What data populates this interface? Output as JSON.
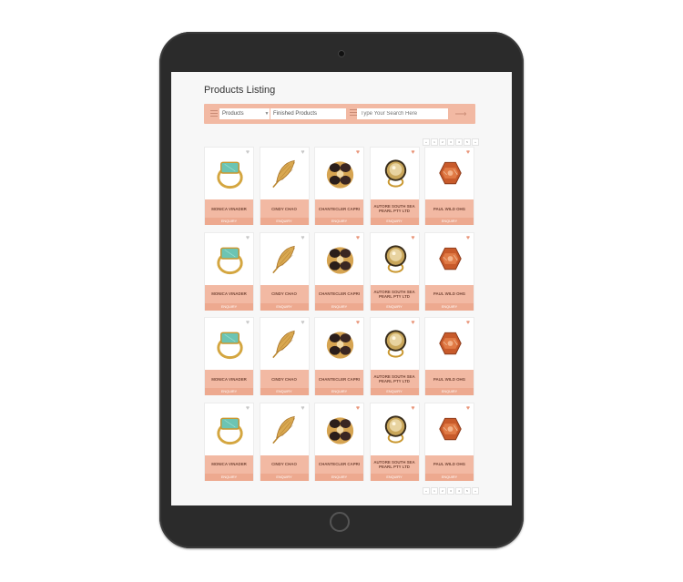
{
  "page": {
    "title": "Products Listing"
  },
  "toolbar": {
    "category_select": "Products",
    "type_select": "Finished Products",
    "search_placeholder": "Type Your Search Here",
    "go_icon": "arrow-right-icon",
    "accent_color": "#f2b9a3"
  },
  "pagination": {
    "pages": [
      "«",
      "1",
      "2",
      "3",
      "4",
      "5",
      "»"
    ]
  },
  "products": [
    {
      "name": "MONICA VINADER",
      "image": "turquoise-ring",
      "favorited": false
    },
    {
      "name": "CINDY CHAO",
      "image": "feather-brooch",
      "favorited": false
    },
    {
      "name": "CHANTECLER CAPRI",
      "image": "black-gold-ring",
      "favorited": true
    },
    {
      "name": "AUTORE SOUTH SEA PEARL PTY LTD",
      "image": "pearl-ring",
      "favorited": true
    },
    {
      "name": "PAUL WILD OHG",
      "image": "orange-gem-ring",
      "favorited": true
    }
  ],
  "card": {
    "action_label": "ENQUIRY"
  },
  "rows": 4
}
